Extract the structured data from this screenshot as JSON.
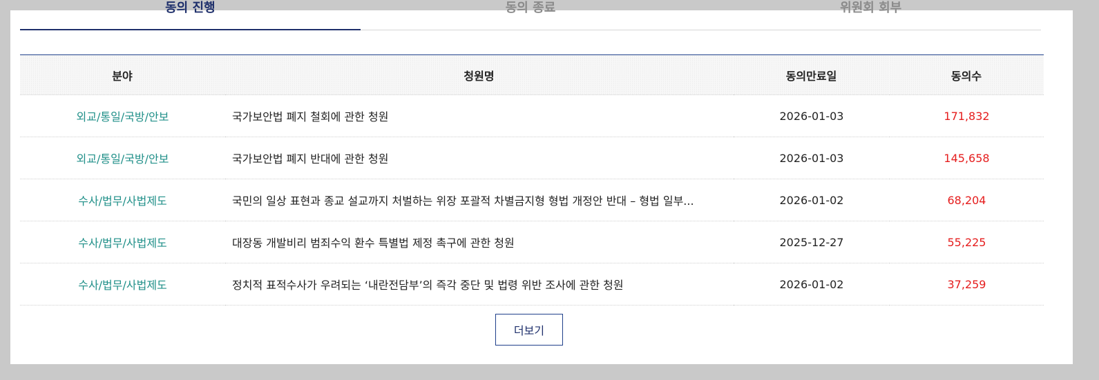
{
  "tabs": [
    {
      "label": "동의 진행"
    },
    {
      "label": "동의 종료"
    },
    {
      "label": "위원회 회부"
    }
  ],
  "table": {
    "headers": {
      "field": "분야",
      "title": "청원명",
      "date": "동의만료일",
      "count": "동의수"
    },
    "rows": [
      {
        "field": "외교/통일/국방/안보",
        "title": "국가보안법 폐지 철회에 관한 청원",
        "date": "2026-01-03",
        "count": "171,832"
      },
      {
        "field": "외교/통일/국방/안보",
        "title": "국가보안법 폐지 반대에 관한 청원",
        "date": "2026-01-03",
        "count": "145,658"
      },
      {
        "field": "수사/법무/사법제도",
        "title": "국민의 일상 표현과 종교 설교까지 처벌하는 위장 포괄적 차별금지형 형법 개정안 반대 – 형법 일부...",
        "date": "2026-01-02",
        "count": "68,204"
      },
      {
        "field": "수사/법무/사법제도",
        "title": "대장동 개발비리 범죄수익 환수 특별법 제정 촉구에 관한 청원",
        "date": "2025-12-27",
        "count": "55,225"
      },
      {
        "field": "수사/법무/사법제도",
        "title": "정치적 표적수사가 우려되는 ‘내란전담부’의 즉각 중단 및 법령 위반 조사에 관한 청원",
        "date": "2026-01-02",
        "count": "37,259"
      }
    ]
  },
  "more_button": {
    "label": "더보기"
  },
  "colors": {
    "accent": "#1e2f6b",
    "field_text": "#1f8f88",
    "count_text": "#e51d1d",
    "inactive_tab": "#8a8a8a"
  }
}
